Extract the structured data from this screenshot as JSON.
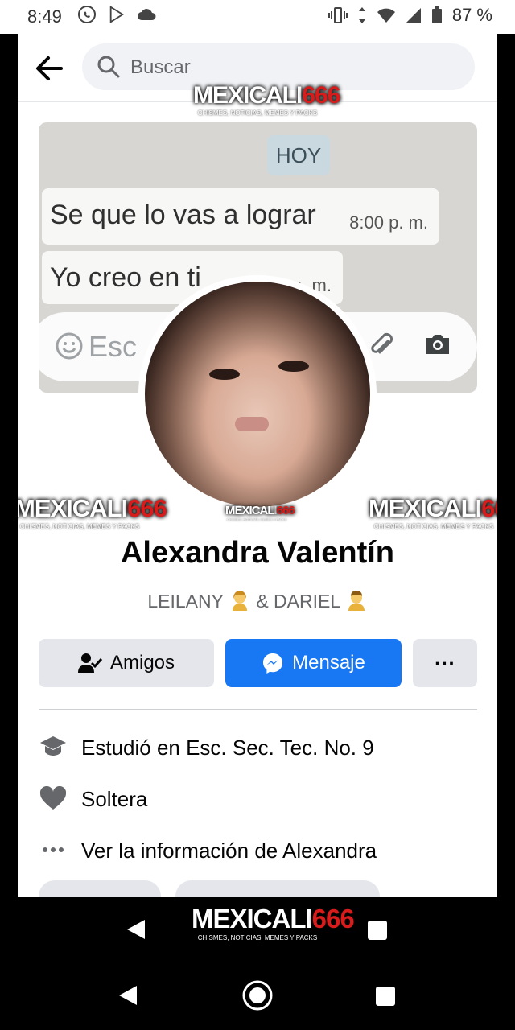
{
  "status_bar": {
    "time": "8:49",
    "battery": "87 %",
    "left_icons": [
      "whatsapp-icon",
      "play-store-icon",
      "cloud-icon"
    ],
    "right_icons": [
      "vibrate-icon",
      "data-arrows-icon",
      "wifi-icon",
      "signal-icon",
      "battery-icon"
    ]
  },
  "header": {
    "search_placeholder": "Buscar"
  },
  "cover": {
    "today_label": "HOY",
    "message1": "Se que lo vas a lograr",
    "message1_time": "8:00 p. m.",
    "message2": "Yo creo en ti",
    "message2_time": "8:00 p. m.",
    "composer_placeholder": "Esc"
  },
  "watermark": {
    "brand_white": "MEXICALI",
    "brand_red": "666",
    "tagline": "CHISMES, NOTICIAS, MEMES Y PACKS"
  },
  "profile": {
    "name": "Alexandra Valentín",
    "bio_part1": "LEILANY",
    "bio_part2": "& DARIEL"
  },
  "actions": {
    "friends_label": "Amigos",
    "message_label": "Mensaje",
    "more_label": "···"
  },
  "info": {
    "education": "Estudió en Esc. Sec. Tec. No. 9",
    "relationship": "Soltera",
    "see_more": "Ver la información de Alexandra"
  },
  "colors": {
    "accent": "#1877f2",
    "button_gray": "#e4e6eb",
    "watermark_red": "#d81b1b"
  }
}
